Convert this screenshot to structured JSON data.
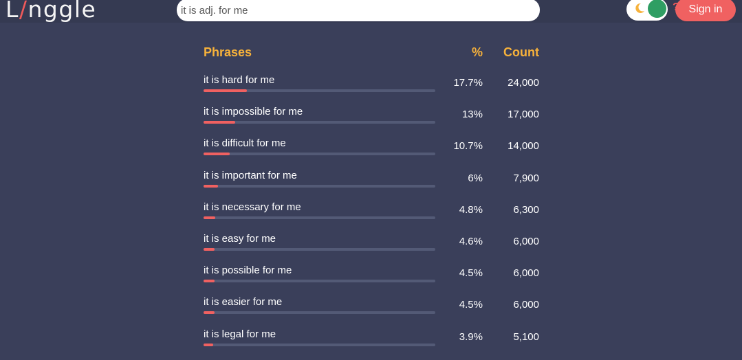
{
  "app": {
    "logo": "Linggle",
    "logo_parts": [
      "L",
      "/",
      "nggle"
    ]
  },
  "search": {
    "value": "it is adj. for me",
    "help_symbol": "?",
    "icon": "search-icon"
  },
  "theme_toggle": {
    "icon": "moon-icon",
    "state": "on",
    "accent": "#2f9e63"
  },
  "auth": {
    "sign_in_label": "Sign in",
    "color": "#f06161"
  },
  "table": {
    "headers": {
      "phrase": "Phrases",
      "percent": "%",
      "count": "Count"
    },
    "rows": [
      {
        "phrase": "it is hard for me",
        "percent": "17.7%",
        "count": "24,000",
        "bar_fraction": 0.177
      },
      {
        "phrase": "it is impossible for me",
        "percent": "13%",
        "count": "17,000",
        "bar_fraction": 0.13
      },
      {
        "phrase": "it is difficult for me",
        "percent": "10.7%",
        "count": "14,000",
        "bar_fraction": 0.107
      },
      {
        "phrase": "it is important for me",
        "percent": "6%",
        "count": "7,900",
        "bar_fraction": 0.06
      },
      {
        "phrase": "it is necessary for me",
        "percent": "4.8%",
        "count": "6,300",
        "bar_fraction": 0.048
      },
      {
        "phrase": "it is easy for me",
        "percent": "4.6%",
        "count": "6,000",
        "bar_fraction": 0.046
      },
      {
        "phrase": "it is possible for me",
        "percent": "4.5%",
        "count": "6,000",
        "bar_fraction": 0.045
      },
      {
        "phrase": "it is easier for me",
        "percent": "4.5%",
        "count": "6,000",
        "bar_fraction": 0.045
      },
      {
        "phrase": "it is legal for me",
        "percent": "3.9%",
        "count": "5,100",
        "bar_fraction": 0.039
      }
    ]
  },
  "colors": {
    "background": "#3a3f5a",
    "header_text": "#f7b23b",
    "bar_fill": "#f06161",
    "bar_track": "#535a76"
  }
}
